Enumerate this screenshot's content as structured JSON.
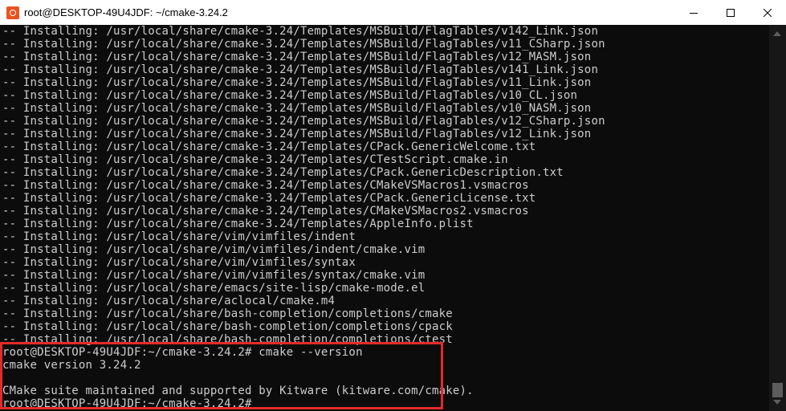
{
  "window": {
    "title": "root@DESKTOP-49U4JDF: ~/cmake-3.24.2",
    "icon": "ubuntu-icon",
    "controls": {
      "minimize": "minimize-icon",
      "maximize": "maximize-icon",
      "close": "close-icon"
    }
  },
  "terminal": {
    "lines": [
      "-- Installing: /usr/local/share/cmake-3.24/Templates/MSBuild/FlagTables/v142_Link.json",
      "-- Installing: /usr/local/share/cmake-3.24/Templates/MSBuild/FlagTables/v11_CSharp.json",
      "-- Installing: /usr/local/share/cmake-3.24/Templates/MSBuild/FlagTables/v12_MASM.json",
      "-- Installing: /usr/local/share/cmake-3.24/Templates/MSBuild/FlagTables/v141_Link.json",
      "-- Installing: /usr/local/share/cmake-3.24/Templates/MSBuild/FlagTables/v11_Link.json",
      "-- Installing: /usr/local/share/cmake-3.24/Templates/MSBuild/FlagTables/v10_CL.json",
      "-- Installing: /usr/local/share/cmake-3.24/Templates/MSBuild/FlagTables/v10_NASM.json",
      "-- Installing: /usr/local/share/cmake-3.24/Templates/MSBuild/FlagTables/v12_CSharp.json",
      "-- Installing: /usr/local/share/cmake-3.24/Templates/MSBuild/FlagTables/v12_Link.json",
      "-- Installing: /usr/local/share/cmake-3.24/Templates/CPack.GenericWelcome.txt",
      "-- Installing: /usr/local/share/cmake-3.24/Templates/CTestScript.cmake.in",
      "-- Installing: /usr/local/share/cmake-3.24/Templates/CPack.GenericDescription.txt",
      "-- Installing: /usr/local/share/cmake-3.24/Templates/CMakeVSMacros1.vsmacros",
      "-- Installing: /usr/local/share/cmake-3.24/Templates/CPack.GenericLicense.txt",
      "-- Installing: /usr/local/share/cmake-3.24/Templates/CMakeVSMacros2.vsmacros",
      "-- Installing: /usr/local/share/cmake-3.24/Templates/AppleInfo.plist",
      "-- Installing: /usr/local/share/vim/vimfiles/indent",
      "-- Installing: /usr/local/share/vim/vimfiles/indent/cmake.vim",
      "-- Installing: /usr/local/share/vim/vimfiles/syntax",
      "-- Installing: /usr/local/share/vim/vimfiles/syntax/cmake.vim",
      "-- Installing: /usr/local/share/emacs/site-lisp/cmake-mode.el",
      "-- Installing: /usr/local/share/aclocal/cmake.m4",
      "-- Installing: /usr/local/share/bash-completion/completions/cmake",
      "-- Installing: /usr/local/share/bash-completion/completions/cpack",
      "-- Installing: /usr/local/share/bash-completion/completions/ctest",
      "root@DESKTOP-49U4JDF:~/cmake-3.24.2# cmake --version",
      "cmake version 3.24.2",
      "",
      "CMake suite maintained and supported by Kitware (kitware.com/cmake).",
      "root@DESKTOP-49U4JDF:~/cmake-3.24.2#"
    ]
  },
  "colors": {
    "background": "#0c0c0c",
    "text": "#cccccc",
    "highlight_border": "#e32a2a",
    "titlebar": "#ffffff"
  }
}
